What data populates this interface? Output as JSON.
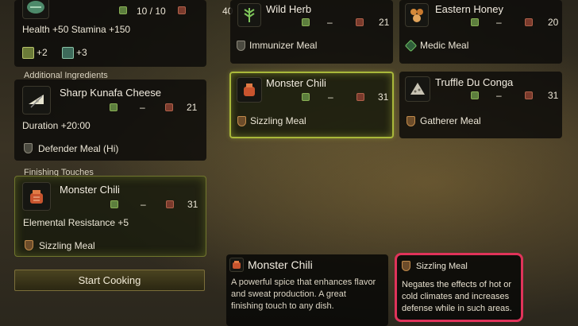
{
  "left": {
    "top_card": {
      "count": "10 / 10",
      "value": "40",
      "effects": "Health +50   Stamina +150",
      "bonus_a": "+2",
      "bonus_b": "+3"
    },
    "additional": {
      "section_title": "Additional Ingredients",
      "name": "Sharp Kunafa Cheese",
      "dash": "–",
      "value": "21",
      "effect": "Duration +20:00",
      "meal": "Defender Meal (Hi)"
    },
    "finishing": {
      "section_title": "Finishing Touches",
      "name": "Monster Chili",
      "dash": "–",
      "value": "31",
      "effect": "Elemental Resistance +5",
      "meal": "Sizzling Meal"
    },
    "start_button": "Start Cooking"
  },
  "grid": [
    {
      "name": "Wild Herb",
      "dash": "–",
      "value": "21",
      "meal": "Immunizer Meal"
    },
    {
      "name": "Eastern Honey",
      "dash": "–",
      "value": "20",
      "meal": "Medic Meal"
    },
    {
      "name": "Monster Chili",
      "dash": "–",
      "value": "31",
      "meal": "Sizzling Meal"
    },
    {
      "name": "Truffle Du Conga",
      "dash": "–",
      "value": "31",
      "meal": "Gatherer Meal"
    }
  ],
  "detail": {
    "name": "Monster Chili",
    "description": "A powerful spice that enhances flavor and sweat production. A great finishing touch to any dish."
  },
  "tooltip": {
    "title": "Sizzling Meal",
    "description": "Negates the effects of hot or cold climates and increases defense while in such areas."
  },
  "colors": {
    "selected_border": "#a9b83a",
    "highlight": "#e0335a"
  }
}
